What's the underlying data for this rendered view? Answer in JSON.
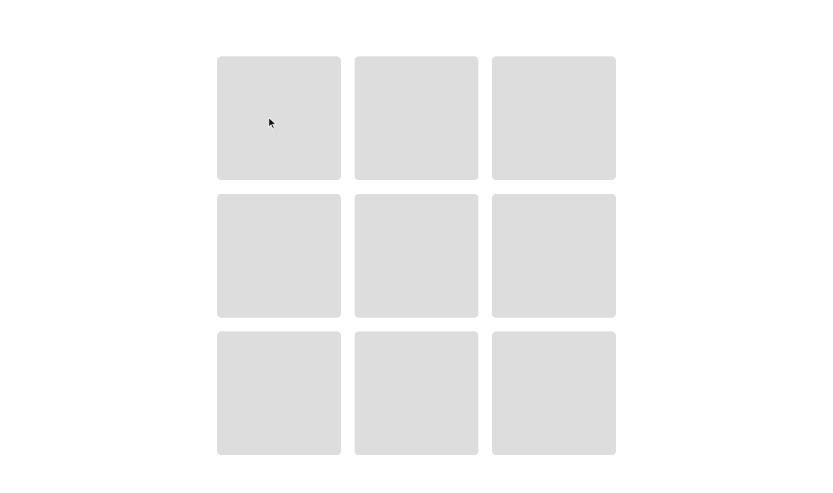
{
  "game": {
    "tile_color": "#dddddd",
    "background_pattern_color": "#ececec",
    "background_icons": [
      "burger-icon",
      "hotdog-icon",
      "ice-cream-cone-icon",
      "soda-cup-icon",
      "fries-icon",
      "donut-icon",
      "taco-icon",
      "popsicle-icon"
    ],
    "tiles": [
      {
        "id": 1,
        "state": "hidden"
      },
      {
        "id": 2,
        "state": "hidden"
      },
      {
        "id": 3,
        "state": "hidden"
      },
      {
        "id": 4,
        "state": "hidden"
      },
      {
        "id": 5,
        "state": "hidden"
      },
      {
        "id": 6,
        "state": "hidden"
      },
      {
        "id": 7,
        "state": "hidden"
      },
      {
        "id": 8,
        "state": "hidden"
      },
      {
        "id": 9,
        "state": "hidden"
      }
    ]
  }
}
